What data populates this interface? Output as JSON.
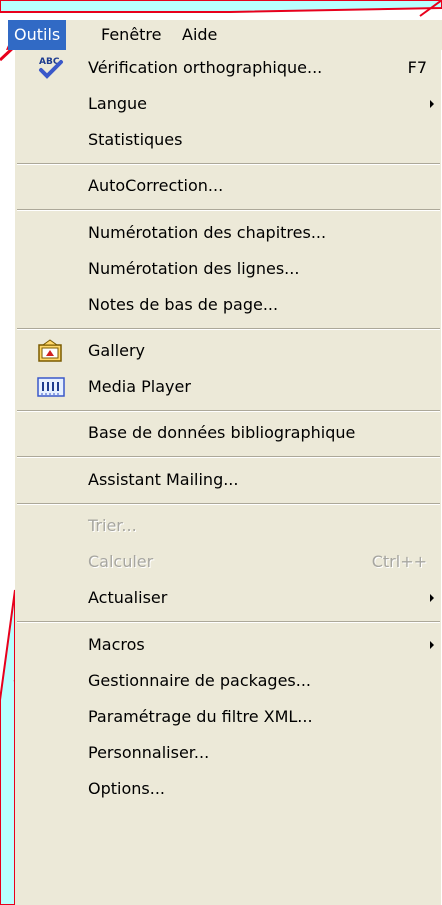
{
  "menubar": {
    "items": [
      {
        "label": "Outils"
      },
      {
        "label": "Fenêtre"
      },
      {
        "label": "Aide"
      }
    ]
  },
  "menu": {
    "spelling": {
      "label": "Vérification orthographique...",
      "shortcut": "F7",
      "icon": "spellcheck-abc-icon"
    },
    "language": {
      "label": "Langue"
    },
    "statistics": {
      "label": "Statistiques"
    },
    "autocorrection": {
      "label": "AutoCorrection..."
    },
    "chapter_numbering": {
      "label": "Numérotation des chapitres..."
    },
    "line_numbering": {
      "label": "Numérotation des lignes..."
    },
    "footnotes": {
      "label": "Notes de bas de page..."
    },
    "gallery": {
      "label": "Gallery",
      "icon": "gallery-icon"
    },
    "media_player": {
      "label": "Media Player",
      "icon": "media-player-icon"
    },
    "bibliography": {
      "label": "Base de données bibliographique"
    },
    "mailing": {
      "label": "Assistant Mailing..."
    },
    "sort": {
      "label": "Trier..."
    },
    "calculate": {
      "label": "Calculer",
      "shortcut": "Ctrl++"
    },
    "update": {
      "label": "Actualiser"
    },
    "macros": {
      "label": "Macros"
    },
    "packages": {
      "label": "Gestionnaire de packages..."
    },
    "xml_filter": {
      "label": "Paramétrage du filtre XML..."
    },
    "customize": {
      "label": "Personnaliser..."
    },
    "options": {
      "label": "Options..."
    }
  },
  "colors": {
    "menu_bg": "#ece9d8",
    "highlight": "#316ac5",
    "disabled_text": "#a7a6a0",
    "annotation_red": "#e8001c",
    "annotation_cyan": "#b8ffff"
  }
}
